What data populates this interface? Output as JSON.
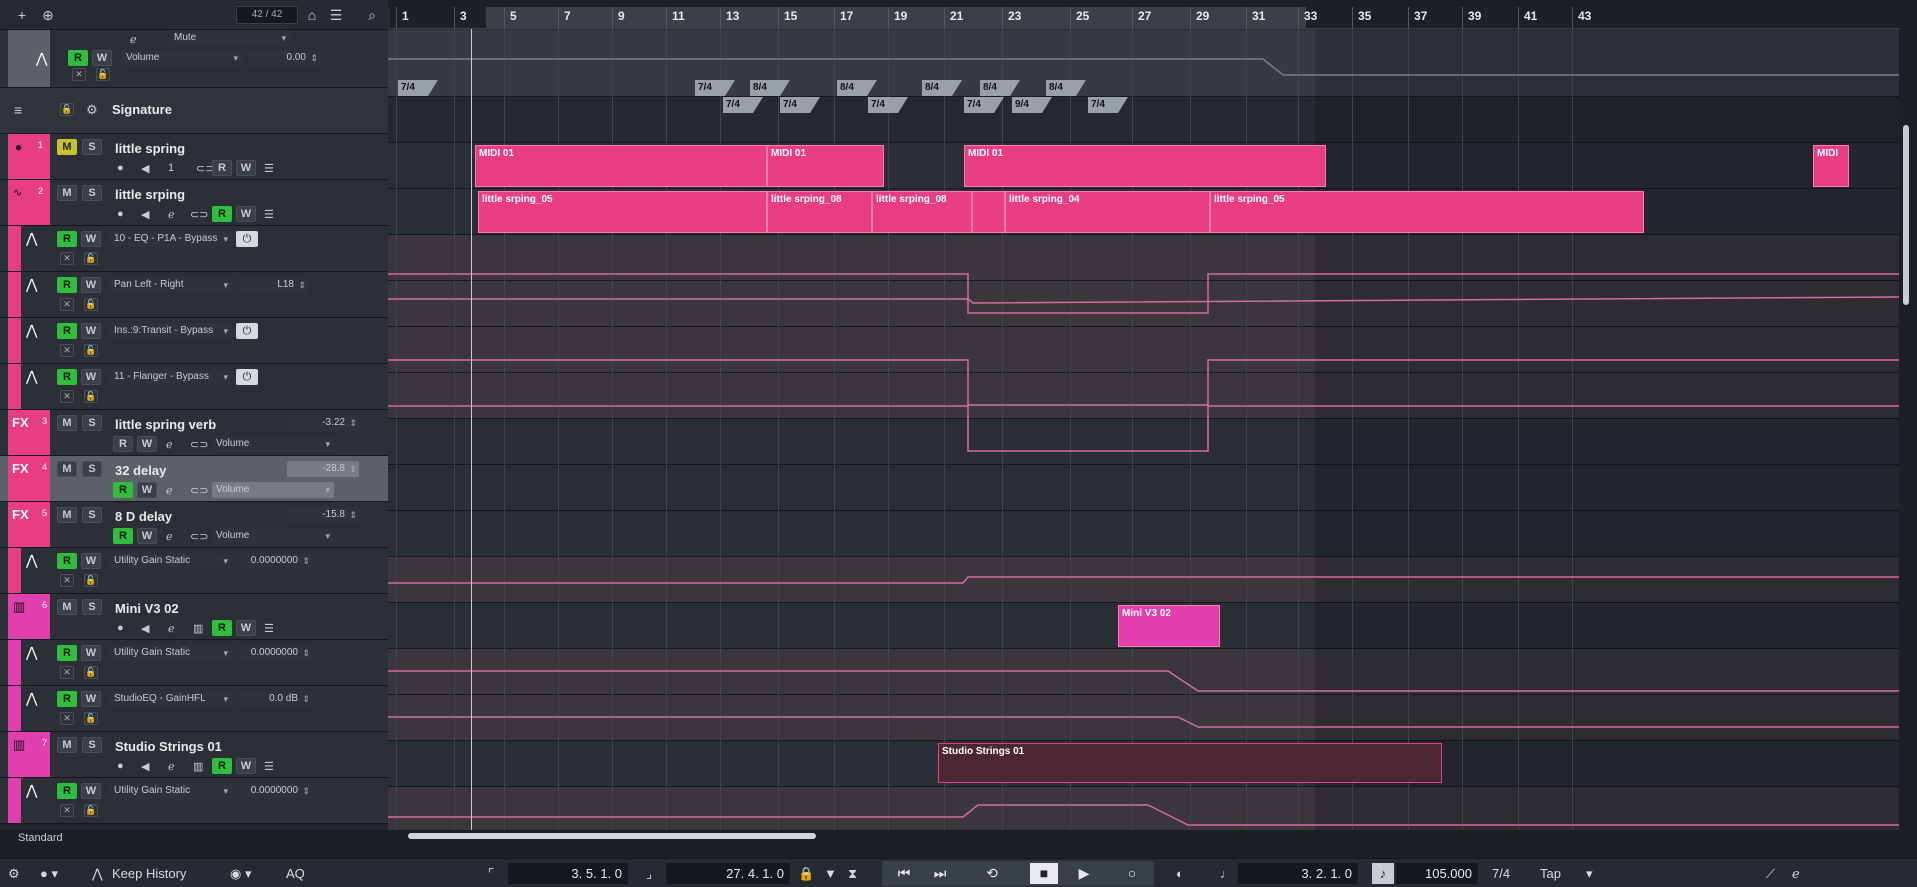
{
  "toolbar": {
    "add_icon": "plus-icon",
    "track_counter": "42 / 42"
  },
  "tracks": [
    {
      "name": "Mute",
      "param": "Volume",
      "value": "0.00"
    },
    {
      "name": "Signature"
    },
    {
      "number": "1",
      "name": "little spring",
      "m": "M",
      "s": "S",
      "r": "R",
      "w": "W"
    },
    {
      "number": "2",
      "name": "little srping",
      "m": "M",
      "s": "S",
      "r": "R",
      "w": "W"
    },
    {
      "param": "10 - EQ - P1A - Bypass"
    },
    {
      "param": "Pan Left - Right",
      "value": "L18"
    },
    {
      "param": "Ins.:9:Transit - Bypass"
    },
    {
      "param": "11 - Flanger - Bypass"
    },
    {
      "prefix": "FX",
      "number": "3",
      "name": "little spring verb",
      "value": "-3.22",
      "param": "Volume"
    },
    {
      "prefix": "FX",
      "number": "4",
      "name": "32 delay",
      "value": "-28.8",
      "param": "Volume"
    },
    {
      "prefix": "FX",
      "number": "5",
      "name": "8 D delay",
      "value": "-15.8",
      "param": "Volume"
    },
    {
      "param": "Utility Gain Static",
      "value": "0.0000000"
    },
    {
      "number": "6",
      "name": "Mini V3 02"
    },
    {
      "param": "Utility Gain Static",
      "value": "0.0000000"
    },
    {
      "param": "StudioEQ - GainHFL",
      "value": "0.0 dB"
    },
    {
      "number": "7",
      "name": "Studio Strings 01"
    },
    {
      "param": "Utility Gain Static",
      "value": "0.0000000"
    }
  ],
  "labels": {
    "m": "M",
    "s": "S",
    "r": "R",
    "w": "W",
    "midi_channel": "1"
  },
  "ruler": [
    "1",
    "3",
    "5",
    "7",
    "9",
    "11",
    "13",
    "15",
    "17",
    "19",
    "21",
    "23",
    "25",
    "27",
    "29",
    "31",
    "33",
    "35",
    "37",
    "39",
    "41",
    "43"
  ],
  "signatures": [
    "7/4",
    "7/4",
    "8/4",
    "7/4",
    "7/4",
    "8/4",
    "7/4",
    "8/4",
    "7/4",
    "8/4",
    "9/4",
    "8/4",
    "7/4"
  ],
  "clips": {
    "midi": [
      "MIDI 01",
      "MIDI 01",
      "MIDI 01",
      "MIDI"
    ],
    "audio": [
      "little srping_05",
      "little srping_08",
      "little srping_08",
      "little srping_04",
      "little srping_05"
    ],
    "mini": "Mini V3 02",
    "strings": "Studio Strings 01"
  },
  "bottom": {
    "preset": "Standard",
    "history": "Keep History",
    "aq": "AQ",
    "left_locator": "3. 5. 1.   0",
    "right_locator": "27. 4. 1.   0",
    "position": "3. 2. 1.   0",
    "tempo": "105.000",
    "signature": "7/4",
    "tap": "Tap"
  }
}
